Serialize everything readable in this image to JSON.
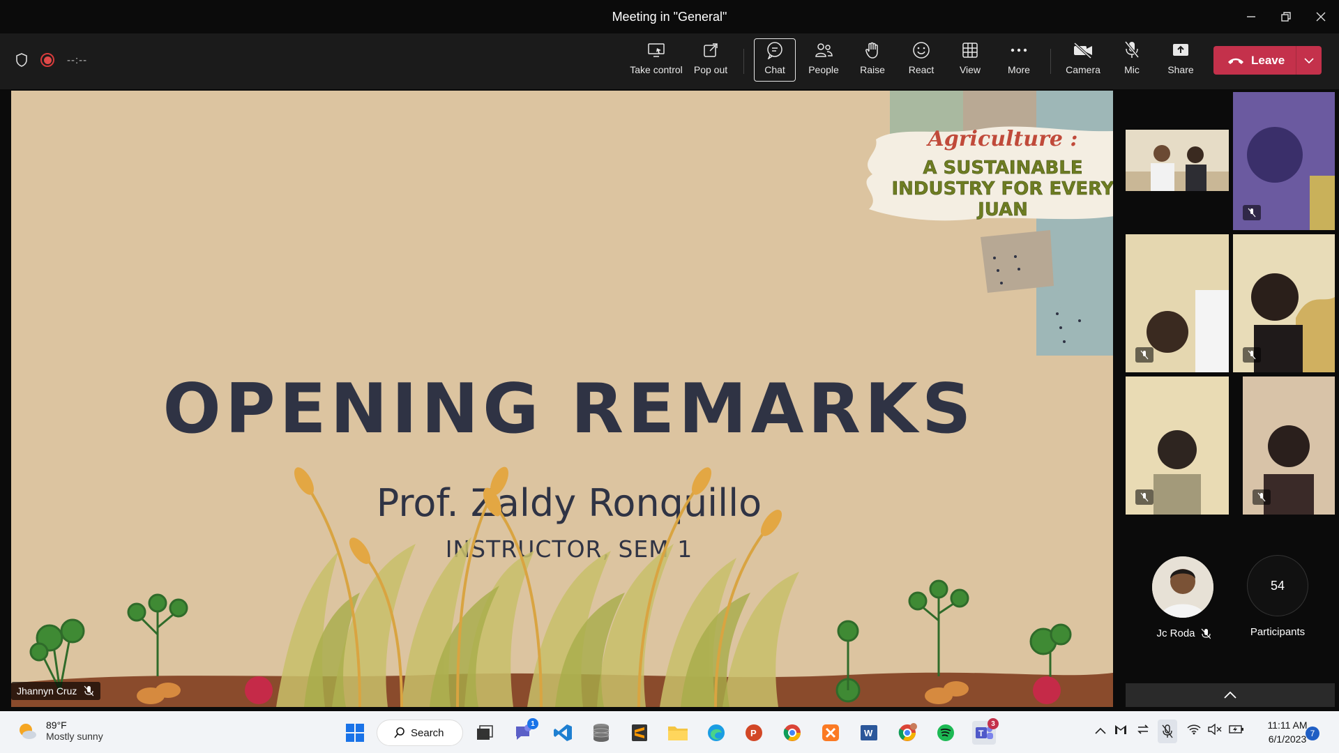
{
  "window": {
    "title": "Meeting in \"General\""
  },
  "toolbar": {
    "timer": "--:--",
    "buttons": {
      "take_control": "Take control",
      "pop_out": "Pop out",
      "chat": "Chat",
      "people": "People",
      "raise": "Raise",
      "react": "React",
      "view": "View",
      "more": "More",
      "camera": "Camera",
      "mic": "Mic",
      "share": "Share"
    },
    "leave": "Leave",
    "accent": "#c4314b"
  },
  "slide": {
    "banner_title": "Agriculture :",
    "banner_subtitle": "A SUSTAINABLE INDUSTRY FOR EVERY JUAN",
    "title": "OPENING REMARKS",
    "name": "Prof. Zaldy Ronquillo",
    "role": "INSTRUCTOR, SEM 1",
    "presenter": "Jhannyn Cruz"
  },
  "panel": {
    "avatar_name": "Jc Roda",
    "participants_count": "54",
    "participants_label": "Participants"
  },
  "taskbar": {
    "weather_temp": "89°F",
    "weather_desc": "Mostly sunny",
    "search": "Search",
    "teams_chat_badge": "1",
    "teams_badge": "3",
    "time": "11:11 AM",
    "date": "6/1/2023",
    "notifications": "7"
  }
}
